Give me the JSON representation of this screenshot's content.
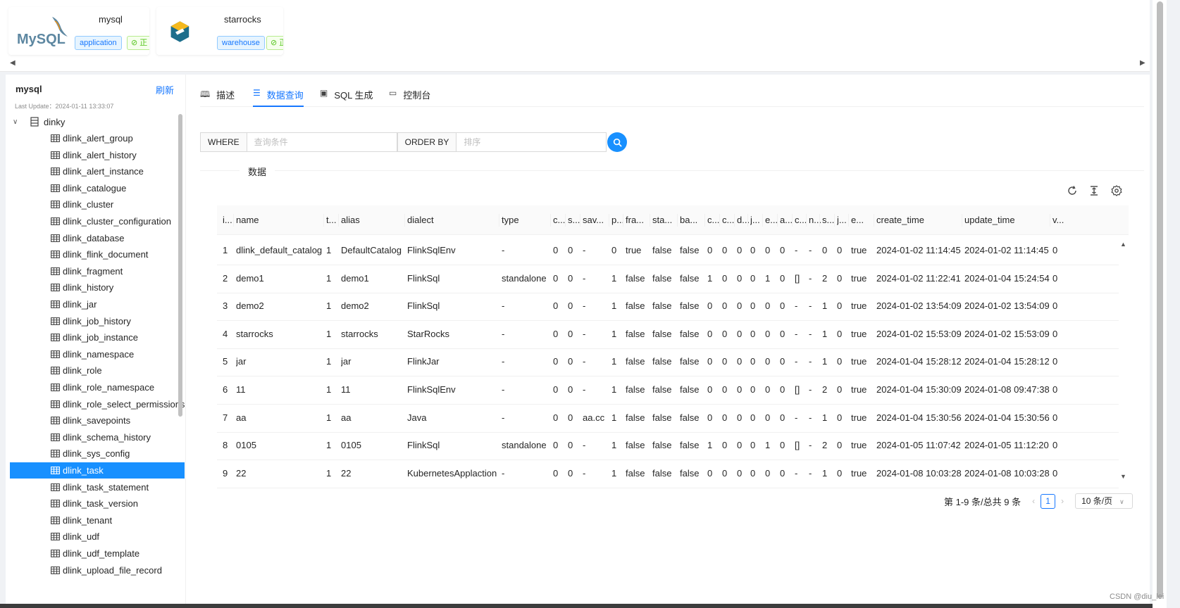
{
  "datasources": [
    {
      "name": "mysql",
      "tag": "application",
      "status": "正",
      "logo": "MySQL"
    },
    {
      "name": "starrocks",
      "tag": "warehouse",
      "status": "正"
    }
  ],
  "sidebar": {
    "title": "mysql",
    "refresh_label": "刷新",
    "last_update": "Last Update：2024-01-11 13:33:07",
    "database": "dinky",
    "selected": "dlink_task",
    "tables": [
      "dlink_alert_group",
      "dlink_alert_history",
      "dlink_alert_instance",
      "dlink_catalogue",
      "dlink_cluster",
      "dlink_cluster_configuration",
      "dlink_database",
      "dlink_flink_document",
      "dlink_fragment",
      "dlink_history",
      "dlink_jar",
      "dlink_job_history",
      "dlink_job_instance",
      "dlink_namespace",
      "dlink_role",
      "dlink_role_namespace",
      "dlink_role_select_permissions",
      "dlink_savepoints",
      "dlink_schema_history",
      "dlink_sys_config",
      "dlink_task",
      "dlink_task_statement",
      "dlink_task_version",
      "dlink_tenant",
      "dlink_udf",
      "dlink_udf_template",
      "dlink_upload_file_record"
    ]
  },
  "tabs": [
    {
      "label": "描述",
      "icon": "book-icon",
      "active": false
    },
    {
      "label": "数据查询",
      "icon": "list-icon",
      "active": true
    },
    {
      "label": "SQL 生成",
      "icon": "monitor-code-icon",
      "active": false
    },
    {
      "label": "控制台",
      "icon": "laptop-icon",
      "active": false
    }
  ],
  "query": {
    "where_label": "WHERE",
    "where_placeholder": "查询条件",
    "order_label": "ORDER BY",
    "order_placeholder": "排序"
  },
  "section_label": "数据",
  "table": {
    "columns": [
      "i...",
      "name",
      "t...",
      "alias",
      "dialect",
      "type",
      "c...",
      "s...",
      "sav...",
      "p...",
      "fra...",
      "sta...",
      "ba...",
      "c...",
      "c...",
      "d...",
      "j...",
      "e...",
      "a...",
      "c...",
      "n...",
      "s...",
      "j...",
      "e...",
      "create_time",
      "update_time",
      "v..."
    ],
    "rows": [
      [
        "1",
        "dlink_default_catalog",
        "1",
        "DefaultCatalog",
        "FlinkSqlEnv",
        "-",
        "0",
        "0",
        "-",
        "0",
        "true",
        "false",
        "false",
        "0",
        "0",
        "0",
        "0",
        "0",
        "0",
        "-",
        "-",
        "0",
        "0",
        "true",
        "2024-01-02 11:14:45",
        "2024-01-02 11:14:45",
        "0"
      ],
      [
        "2",
        "demo1",
        "1",
        "demo1",
        "FlinkSql",
        "standalone",
        "0",
        "0",
        "-",
        "1",
        "false",
        "false",
        "false",
        "1",
        "0",
        "0",
        "0",
        "1",
        "0",
        "[]",
        "-",
        "2",
        "0",
        "true",
        "2024-01-02 11:22:41",
        "2024-01-04 15:24:54",
        "0"
      ],
      [
        "3",
        "demo2",
        "1",
        "demo2",
        "FlinkSql",
        "-",
        "0",
        "0",
        "-",
        "1",
        "false",
        "false",
        "false",
        "0",
        "0",
        "0",
        "0",
        "0",
        "0",
        "-",
        "-",
        "1",
        "0",
        "true",
        "2024-01-02 13:54:09",
        "2024-01-02 13:54:09",
        "0"
      ],
      [
        "4",
        "starrocks",
        "1",
        "starrocks",
        "StarRocks",
        "-",
        "0",
        "0",
        "-",
        "1",
        "false",
        "false",
        "false",
        "0",
        "0",
        "0",
        "0",
        "0",
        "0",
        "-",
        "-",
        "1",
        "0",
        "true",
        "2024-01-02 15:53:09",
        "2024-01-02 15:53:09",
        "0"
      ],
      [
        "5",
        "jar",
        "1",
        "jar",
        "FlinkJar",
        "-",
        "0",
        "0",
        "-",
        "1",
        "false",
        "false",
        "false",
        "0",
        "0",
        "0",
        "0",
        "0",
        "0",
        "-",
        "-",
        "1",
        "0",
        "true",
        "2024-01-04 15:28:12",
        "2024-01-04 15:28:12",
        "0"
      ],
      [
        "6",
        "11",
        "1",
        "11",
        "FlinkSqlEnv",
        "-",
        "0",
        "0",
        "-",
        "1",
        "false",
        "false",
        "false",
        "0",
        "0",
        "0",
        "0",
        "0",
        "0",
        "[]",
        "-",
        "2",
        "0",
        "true",
        "2024-01-04 15:30:09",
        "2024-01-08 09:47:38",
        "0"
      ],
      [
        "7",
        "aa",
        "1",
        "aa",
        "Java",
        "-",
        "0",
        "0",
        "aa.cc",
        "1",
        "false",
        "false",
        "false",
        "0",
        "0",
        "0",
        "0",
        "0",
        "0",
        "-",
        "-",
        "1",
        "0",
        "true",
        "2024-01-04 15:30:56",
        "2024-01-04 15:30:56",
        "0"
      ],
      [
        "8",
        "0105",
        "1",
        "0105",
        "FlinkSql",
        "standalone",
        "0",
        "0",
        "-",
        "1",
        "false",
        "false",
        "false",
        "1",
        "0",
        "0",
        "0",
        "1",
        "0",
        "[]",
        "-",
        "2",
        "0",
        "true",
        "2024-01-05 11:07:42",
        "2024-01-05 11:12:20",
        "0"
      ],
      [
        "9",
        "22",
        "1",
        "22",
        "KubernetesApplaction",
        "-",
        "0",
        "0",
        "-",
        "1",
        "false",
        "false",
        "false",
        "0",
        "0",
        "0",
        "0",
        "0",
        "0",
        "-",
        "-",
        "1",
        "0",
        "true",
        "2024-01-08 10:03:28",
        "2024-01-08 10:03:28",
        "0"
      ]
    ]
  },
  "pagination": {
    "summary": "第 1-9 条/总共 9 条",
    "current_page": "1",
    "page_size": "10 条/页"
  },
  "footer_watermark": "CSDN @diu_lei",
  "colors": {
    "accent": "#1677ff",
    "selected_bg": "#1890ff"
  }
}
